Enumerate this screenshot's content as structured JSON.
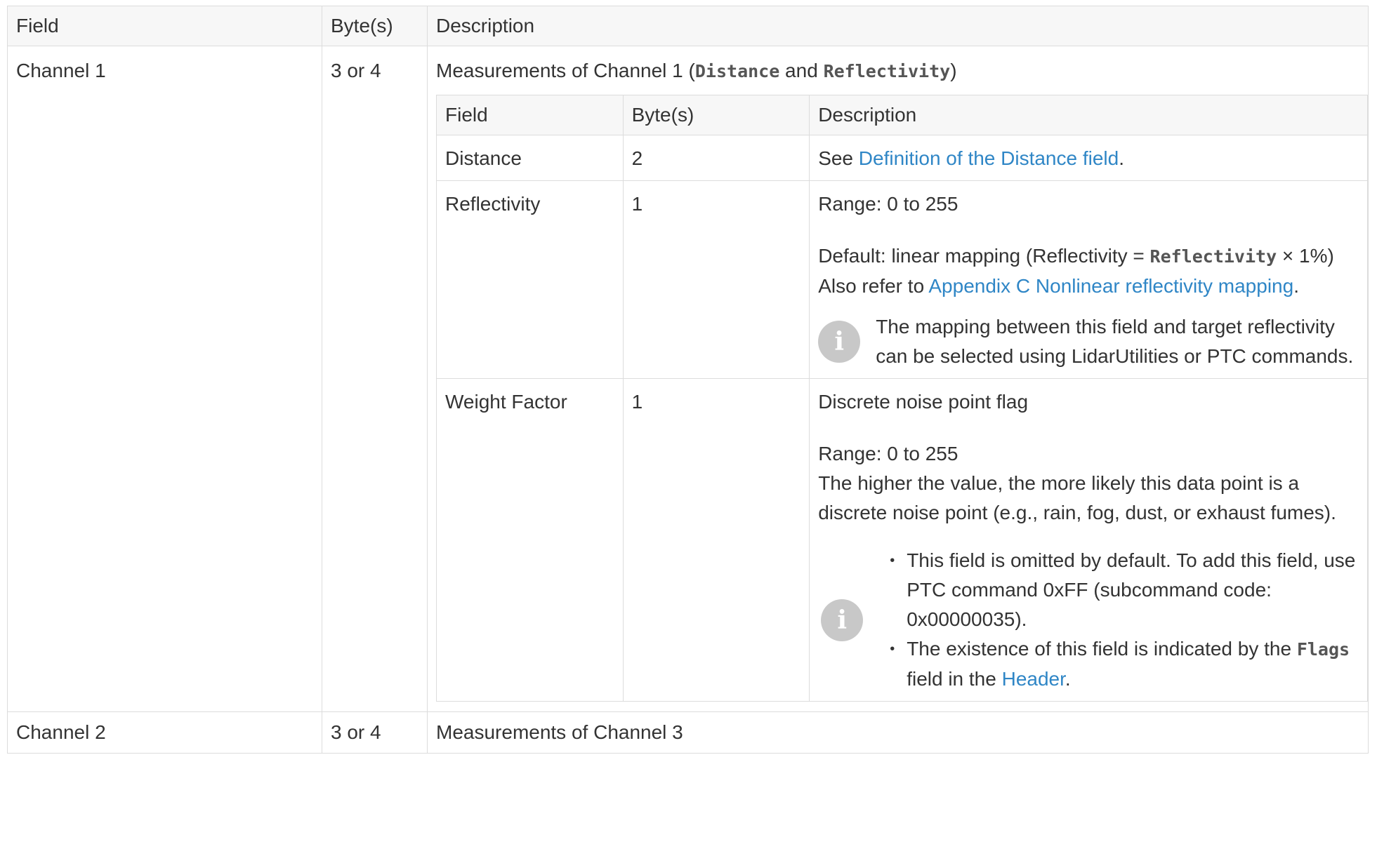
{
  "headers": [
    "Field",
    "Byte(s)",
    "Description"
  ],
  "channel1": {
    "field": "Channel 1",
    "bytes": "3 or 4",
    "desc_prefix": "Measurements of Channel 1 (",
    "desc_code1": "Distance",
    "desc_and": " and ",
    "desc_code2": "Reflectivity",
    "desc_suffix": ")"
  },
  "inner_headers": [
    "Field",
    "Byte(s)",
    "Description"
  ],
  "distance": {
    "field": "Distance",
    "bytes": "2",
    "desc_prefix": "See ",
    "desc_link": "Definition of the Distance field",
    "desc_suffix": "."
  },
  "reflectivity": {
    "field": "Reflectivity",
    "bytes": "1",
    "range": "Range: 0 to 255",
    "default_prefix": "Default: linear mapping (Reflectivity = ",
    "default_code": "Reflectivity",
    "default_suffix": " × 1%)",
    "refer_prefix": "Also refer to ",
    "refer_link": "Appendix C Nonlinear reflectivity mapping",
    "refer_suffix": ".",
    "note": "The mapping between this field and target reflectivity can be selected using LidarUtilities or PTC commands."
  },
  "weight": {
    "field": "Weight Factor",
    "bytes": "1",
    "desc1": "Discrete noise point flag",
    "range": "Range: 0 to 255",
    "desc2": "The higher the value, the more likely this data point is a discrete noise point (e.g., rain, fog, dust, or exhaust fumes).",
    "note_item1": "This field is omitted by default. To add this field, use PTC command 0xFF (subcommand code: 0x00000035).",
    "note_item2_prefix": "The existence of this field is indicated by the ",
    "note_item2_code": "Flags",
    "note_item2_mid": " field in the ",
    "note_item2_link": "Header",
    "note_item2_suffix": "."
  },
  "channel2": {
    "field": "Channel 2",
    "bytes": "3 or 4",
    "desc": "Measurements of Channel 3"
  },
  "icons": {
    "info": "info-icon",
    "info_glyph": "i"
  },
  "colors": {
    "link": "#2f86c6",
    "border": "#dcdcdc",
    "header_bg": "#f7f7f7",
    "icon_bg": "#c8c8c8"
  }
}
